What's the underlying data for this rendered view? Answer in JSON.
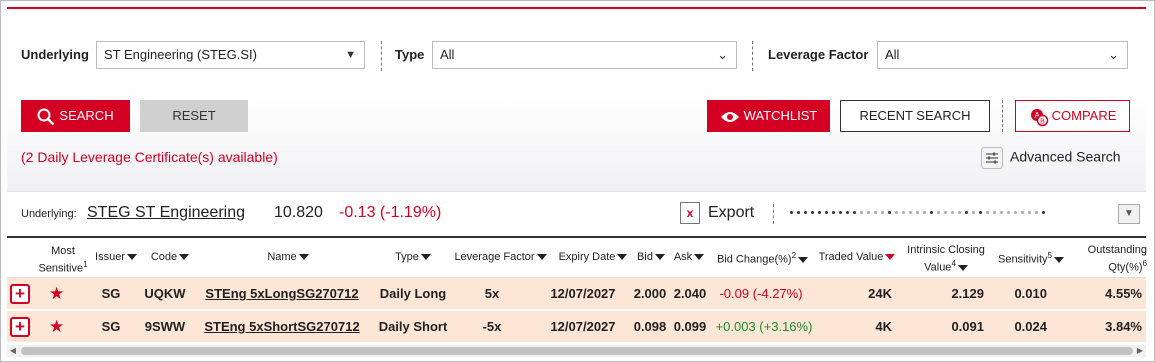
{
  "filters": {
    "underlying_label": "Underlying",
    "underlying_value": "ST Engineering (STEG.SI)",
    "type_label": "Type",
    "type_value": "All",
    "leverage_label": "Leverage Factor",
    "leverage_value": "All"
  },
  "buttons": {
    "search": "SEARCH",
    "reset": "RESET",
    "watchlist": "WATCHLIST",
    "recent_search": "RECENT SEARCH",
    "compare": "COMPARE"
  },
  "availability": "(2 Daily Leverage Certificate(s) available)",
  "advanced_search": "Advanced Search",
  "underlying_info": {
    "label": "Underlying:",
    "name": "STEG ST Engineering",
    "price": "10.820",
    "change": "-0.13 (-1.19%)"
  },
  "export_label": "Export",
  "table": {
    "headers": {
      "most_sensitive": "Most Sensitive",
      "most_sensitive_sup": "1",
      "issuer": "Issuer",
      "code": "Code",
      "name": "Name",
      "type": "Type",
      "leverage": "Leverage Factor",
      "expiry": "Expiry Date",
      "bid": "Bid",
      "ask": "Ask",
      "bid_change": "Bid Change(%)",
      "bid_change_sup": "2",
      "traded_value": "Traded Value",
      "intrinsic": "Intrinsic Closing Value",
      "intrinsic_sup": "4",
      "sensitivity": "Sensitivity",
      "sensitivity_sup": "5",
      "outstanding": "Outstanding Qty(%)",
      "outstanding_sup": "6"
    },
    "rows": [
      {
        "issuer": "SG",
        "code": "UQKW",
        "name": "STEng 5xLongSG270712",
        "type": "Daily Long",
        "leverage": "5x",
        "expiry": "12/07/2027",
        "bid": "2.000",
        "ask": "2.040",
        "bid_change": "-0.09 (-4.27%)",
        "traded_value": "24K",
        "intrinsic": "2.129",
        "sensitivity": "0.010",
        "outstanding": "4.55%"
      },
      {
        "issuer": "SG",
        "code": "9SWW",
        "name": "STEng 5xShortSG270712",
        "type": "Daily Short",
        "leverage": "-5x",
        "expiry": "12/07/2027",
        "bid": "0.098",
        "ask": "0.099",
        "bid_change": "+0.003 (+3.16%)",
        "traded_value": "4K",
        "intrinsic": "0.091",
        "sensitivity": "0.024",
        "outstanding": "3.84%"
      }
    ]
  },
  "colors": {
    "accent": "#d40023",
    "row_bg": "#fde6d6",
    "positive": "#1a8f2e"
  }
}
